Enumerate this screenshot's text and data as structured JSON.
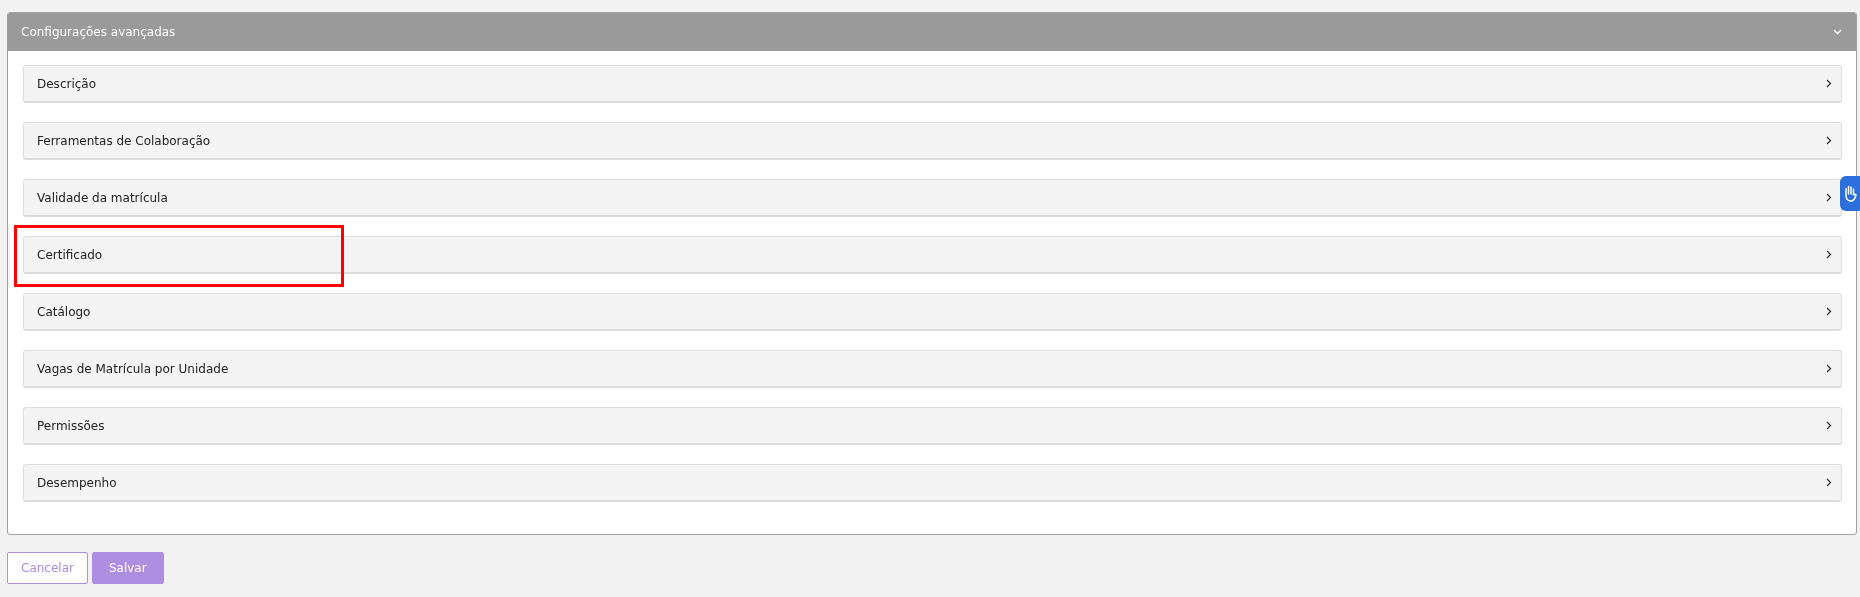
{
  "panel": {
    "title": "Configurações avançadas",
    "expanded": true
  },
  "sections": [
    {
      "label": "Descrição",
      "highlighted": false
    },
    {
      "label": "Ferramentas de Colaboração",
      "highlighted": false
    },
    {
      "label": "Validade da matrícula",
      "highlighted": false
    },
    {
      "label": "Certificado",
      "highlighted": true
    },
    {
      "label": "Catálogo",
      "highlighted": false
    },
    {
      "label": "Vagas de Matrícula por Unidade",
      "highlighted": false
    },
    {
      "label": "Permissões",
      "highlighted": false
    },
    {
      "label": "Desempenho",
      "highlighted": false
    }
  ],
  "buttons": [
    {
      "label": "Cancelar",
      "kind": "outline"
    },
    {
      "label": "Salvar",
      "kind": "primary"
    }
  ]
}
